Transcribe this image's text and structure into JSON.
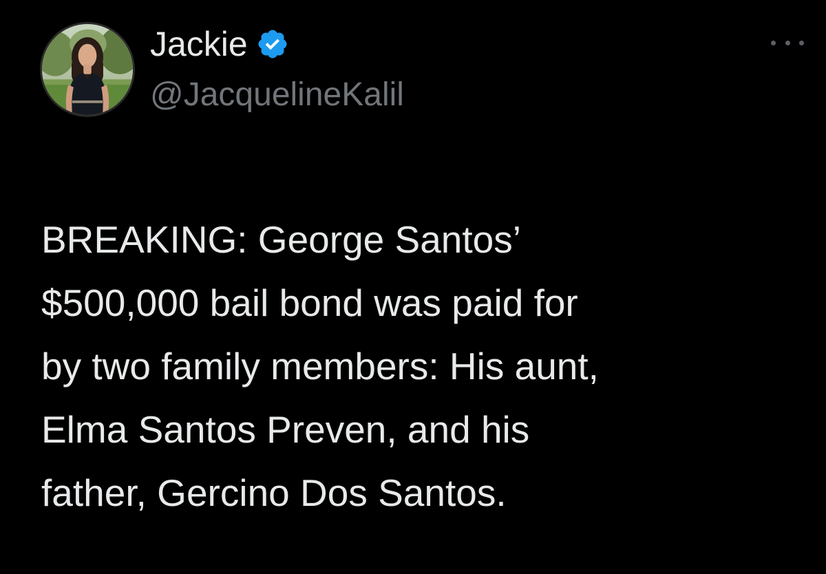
{
  "tweet": {
    "author": {
      "display_name": "Jackie",
      "handle": "@JacquelineKalil",
      "verified": true,
      "avatar_icon": "profile-photo"
    },
    "more_icon": "more-horizontal-icon",
    "text": "BREAKING: George Santos’\n$500,000 bail bond was paid for\nby two family members: His aunt,\nElma Santos Preven, and his\nfather, Gercino Dos Santos."
  },
  "colors": {
    "background": "#000000",
    "primary_text": "#e7e9ea",
    "secondary_text": "#71767b",
    "verified_badge": "#1d9bf0"
  }
}
